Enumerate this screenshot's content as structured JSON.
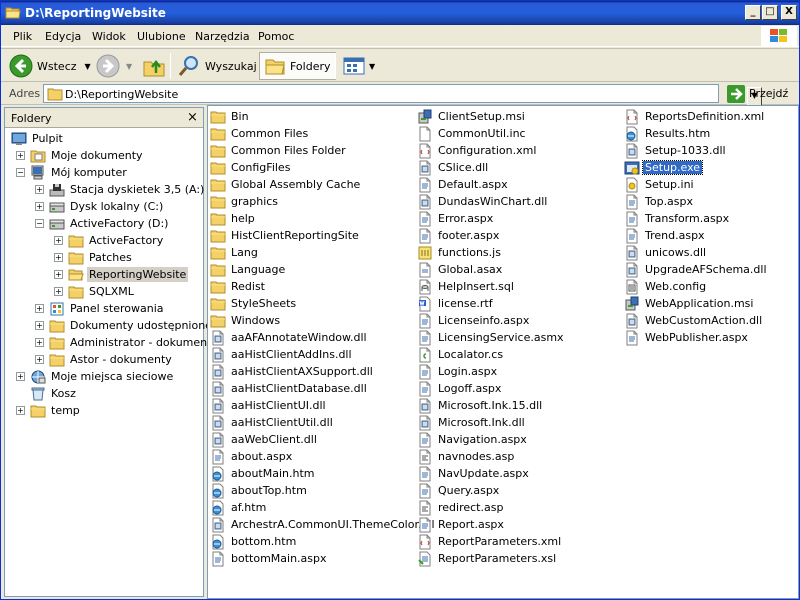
{
  "window": {
    "title": "D:\\ReportingWebsite",
    "min_label": "_",
    "max_label": "□",
    "close_label": "X"
  },
  "menu": [
    "Plik",
    "Edycja",
    "Widok",
    "Ulubione",
    "Narzędzia",
    "Pomoc"
  ],
  "toolbar": {
    "back_label": "Wstecz",
    "search_label": "Wyszukaj",
    "folders_label": "Foldery"
  },
  "address": {
    "label": "Adres",
    "value": "D:\\ReportingWebsite",
    "go_label": "Przejdź"
  },
  "folders_pane": {
    "title": "Foldery",
    "close": "×",
    "tree": [
      {
        "label": "Pulpit",
        "icon": "desktop-icon",
        "level": 0,
        "expander": ""
      },
      {
        "label": "Moje dokumenty",
        "icon": "my-documents-icon",
        "level": 1,
        "expander": "+"
      },
      {
        "label": "Mój komputer",
        "icon": "my-computer-icon",
        "level": 1,
        "expander": "-"
      },
      {
        "label": "Stacja dyskietek 3,5 (A:)",
        "icon": "floppy-drive-icon",
        "level": 2,
        "expander": "+"
      },
      {
        "label": "Dysk lokalny (C:)",
        "icon": "hard-drive-icon",
        "level": 2,
        "expander": "+"
      },
      {
        "label": "ActiveFactory (D:)",
        "icon": "hard-drive-icon",
        "level": 2,
        "expander": "-"
      },
      {
        "label": "ActiveFactory",
        "icon": "folder-icon",
        "level": 3,
        "expander": "+"
      },
      {
        "label": "Patches",
        "icon": "folder-icon",
        "level": 3,
        "expander": "+"
      },
      {
        "label": "ReportingWebsite",
        "icon": "folder-open-icon",
        "level": 3,
        "expander": "+",
        "selected": true
      },
      {
        "label": "SQLXML",
        "icon": "folder-icon",
        "level": 3,
        "expander": "+"
      },
      {
        "label": "Panel sterowania",
        "icon": "control-panel-icon",
        "level": 2,
        "expander": "+"
      },
      {
        "label": "Dokumenty udostępnione",
        "icon": "folder-icon",
        "level": 2,
        "expander": "+"
      },
      {
        "label": "Administrator - dokumenty",
        "icon": "folder-icon",
        "level": 2,
        "expander": "+"
      },
      {
        "label": "Astor - dokumenty",
        "icon": "folder-icon",
        "level": 2,
        "expander": "+"
      },
      {
        "label": "Moje miejsca sieciowe",
        "icon": "network-places-icon",
        "level": 1,
        "expander": "+"
      },
      {
        "label": "Kosz",
        "icon": "recycle-bin-icon",
        "level": 1,
        "expander": ""
      },
      {
        "label": "temp",
        "icon": "folder-icon",
        "level": 1,
        "expander": "+"
      }
    ]
  },
  "files": {
    "columns": [
      [
        {
          "name": "Bin",
          "icon": "folder-icon"
        },
        {
          "name": "Common Files",
          "icon": "folder-icon"
        },
        {
          "name": "Common Files Folder",
          "icon": "folder-icon"
        },
        {
          "name": "ConfigFiles",
          "icon": "folder-icon"
        },
        {
          "name": "Global Assembly Cache",
          "icon": "folder-icon"
        },
        {
          "name": "graphics",
          "icon": "folder-icon"
        },
        {
          "name": "help",
          "icon": "folder-icon"
        },
        {
          "name": "HistClientReportingSite",
          "icon": "folder-icon"
        },
        {
          "name": "Lang",
          "icon": "folder-icon"
        },
        {
          "name": "Language",
          "icon": "folder-icon"
        },
        {
          "name": "Redist",
          "icon": "folder-icon"
        },
        {
          "name": "StyleSheets",
          "icon": "folder-icon"
        },
        {
          "name": "Windows",
          "icon": "folder-icon"
        },
        {
          "name": "aaAFAnnotateWindow.dll",
          "icon": "dll-file-icon"
        },
        {
          "name": "aaHistClientAddIns.dll",
          "icon": "dll-file-icon"
        },
        {
          "name": "aaHistClientAXSupport.dll",
          "icon": "dll-file-icon"
        },
        {
          "name": "aaHistClientDatabase.dll",
          "icon": "dll-file-icon"
        },
        {
          "name": "aaHistClientUI.dll",
          "icon": "dll-file-icon"
        },
        {
          "name": "aaHistClientUtil.dll",
          "icon": "dll-file-icon"
        },
        {
          "name": "aaWebClient.dll",
          "icon": "dll-file-icon"
        },
        {
          "name": "about.aspx",
          "icon": "aspx-file-icon"
        },
        {
          "name": "aboutMain.htm",
          "icon": "html-file-icon"
        },
        {
          "name": "aboutTop.htm",
          "icon": "html-file-icon"
        },
        {
          "name": "af.htm",
          "icon": "html-file-icon"
        },
        {
          "name": "ArchestrA.CommonUI.ThemeColor.dll",
          "icon": "dll-file-icon"
        },
        {
          "name": "bottom.htm",
          "icon": "html-file-icon"
        },
        {
          "name": "bottomMain.aspx",
          "icon": "aspx-file-icon"
        }
      ],
      [
        {
          "name": "ClientSetup.msi",
          "icon": "msi-file-icon"
        },
        {
          "name": "CommonUtil.inc",
          "icon": "generic-file-icon"
        },
        {
          "name": "Configuration.xml",
          "icon": "xml-file-icon"
        },
        {
          "name": "CSlice.dll",
          "icon": "dll-file-icon"
        },
        {
          "name": "Default.aspx",
          "icon": "aspx-file-icon"
        },
        {
          "name": "DundasWinChart.dll",
          "icon": "dll-file-icon"
        },
        {
          "name": "Error.aspx",
          "icon": "aspx-file-icon"
        },
        {
          "name": "footer.aspx",
          "icon": "aspx-file-icon"
        },
        {
          "name": "functions.js",
          "icon": "js-file-icon"
        },
        {
          "name": "Global.asax",
          "icon": "asax-file-icon"
        },
        {
          "name": "HelpInsert.sql",
          "icon": "sql-file-icon"
        },
        {
          "name": "license.rtf",
          "icon": "rtf-file-icon"
        },
        {
          "name": "Licenseinfo.aspx",
          "icon": "aspx-file-icon"
        },
        {
          "name": "LicensingService.asmx",
          "icon": "aspx-file-icon"
        },
        {
          "name": "Localator.cs",
          "icon": "cs-file-icon"
        },
        {
          "name": "Login.aspx",
          "icon": "aspx-file-icon"
        },
        {
          "name": "Logoff.aspx",
          "icon": "aspx-file-icon"
        },
        {
          "name": "Microsoft.Ink.15.dll",
          "icon": "dll-file-icon"
        },
        {
          "name": "Microsoft.Ink.dll",
          "icon": "dll-file-icon"
        },
        {
          "name": "Navigation.aspx",
          "icon": "aspx-file-icon"
        },
        {
          "name": "navnodes.asp",
          "icon": "asp-file-icon"
        },
        {
          "name": "NavUpdate.aspx",
          "icon": "aspx-file-icon"
        },
        {
          "name": "Query.aspx",
          "icon": "aspx-file-icon"
        },
        {
          "name": "redirect.asp",
          "icon": "asp-file-icon"
        },
        {
          "name": "Report.aspx",
          "icon": "aspx-file-icon"
        },
        {
          "name": "ReportParameters.xml",
          "icon": "xml-file-icon"
        },
        {
          "name": "ReportParameters.xsl",
          "icon": "xsl-file-icon"
        }
      ],
      [
        {
          "name": "ReportsDefinition.xml",
          "icon": "xml-file-icon"
        },
        {
          "name": "Results.htm",
          "icon": "html-file-icon"
        },
        {
          "name": "Setup-1033.dll",
          "icon": "dll-file-icon"
        },
        {
          "name": "Setup.exe",
          "icon": "exe-file-icon",
          "selected": true
        },
        {
          "name": "Setup.ini",
          "icon": "ini-file-icon"
        },
        {
          "name": "Top.aspx",
          "icon": "aspx-file-icon"
        },
        {
          "name": "Transform.aspx",
          "icon": "aspx-file-icon"
        },
        {
          "name": "Trend.aspx",
          "icon": "aspx-file-icon"
        },
        {
          "name": "unicows.dll",
          "icon": "dll-file-icon"
        },
        {
          "name": "UpgradeAFSchema.dll",
          "icon": "dll-file-icon"
        },
        {
          "name": "Web.config",
          "icon": "config-file-icon"
        },
        {
          "name": "WebApplication.msi",
          "icon": "msi-file-icon"
        },
        {
          "name": "WebCustomAction.dll",
          "icon": "dll-file-icon"
        },
        {
          "name": "WebPublisher.aspx",
          "icon": "aspx-file-icon"
        }
      ]
    ]
  },
  "colors": {
    "titlebar": "#245edb",
    "selection": "#316ac5",
    "folder": "#f3d166",
    "chrome": "#ece9d8"
  }
}
